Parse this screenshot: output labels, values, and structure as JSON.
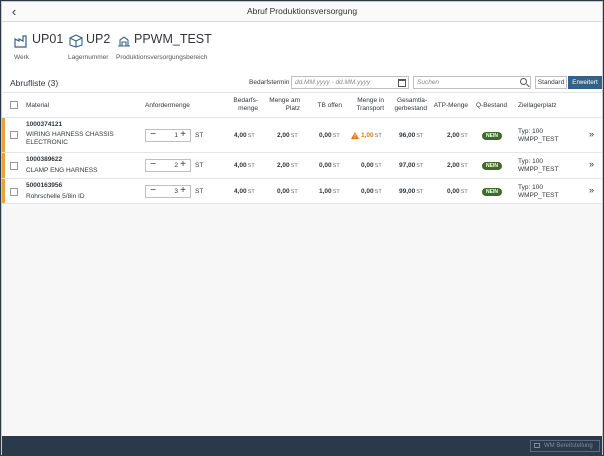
{
  "window": {
    "title": "Abruf Produktionsversorgung"
  },
  "header": {
    "items": [
      {
        "value": "UP01",
        "label": "Werk",
        "icon": "factory-icon"
      },
      {
        "value": "UP2",
        "label": "Lagernummer",
        "icon": "warehouse-box-icon"
      },
      {
        "value": "PPWM_TEST",
        "label": "Produktionsversorgungsbereich",
        "icon": "supply-area-icon"
      }
    ]
  },
  "list": {
    "title": "Abrufliste (3)",
    "date_label": "Bedarfstermin",
    "date_placeholder": "dd.MM.yyyy - dd.MM.yyyy",
    "search_placeholder": "Suchen",
    "btn_standard": "Standard",
    "btn_erweitert": "Erweitert"
  },
  "columns": {
    "material": "Material",
    "anfordermenge": "Anfordermenge",
    "bedarfsmenge": [
      "Bedarfs-",
      "menge"
    ],
    "menge_platz": [
      "Menge am",
      "Platz"
    ],
    "tb_offen": "TB offen",
    "transport": [
      "Menge in",
      "Transport"
    ],
    "gesamt": [
      "Gesamtla-",
      "gerbestand"
    ],
    "atp": "ATP-Menge",
    "qbestand": "Q-Bestand",
    "ziellager": "Ziellagerplatz"
  },
  "rows": [
    {
      "material": "1000374121",
      "desc_1": "WIRING HARNESS CHASSIS",
      "desc_2": "ELECTRONIC",
      "qty": "1",
      "unit": "ST",
      "bedarf": "4,00",
      "platz": "2,00",
      "tb": "0,00",
      "transport": "1,00",
      "gesamt": "96,00",
      "atp": "2,00",
      "u": "ST",
      "q": "NEIN",
      "typ": "Typ: 100",
      "platz_name": "WMPP_TEST",
      "transport_warning": true
    },
    {
      "material": "1000389622",
      "desc_1": "CLAMP ENG HARNESS",
      "desc_2": "",
      "qty": "2",
      "unit": "ST",
      "bedarf": "4,00",
      "platz": "2,00",
      "tb": "0,00",
      "transport": "0,00",
      "gesamt": "97,00",
      "atp": "2,00",
      "u": "ST",
      "q": "NEIN",
      "typ": "Typ: 100",
      "platz_name": "WMPP_TEST",
      "transport_warning": false
    },
    {
      "material": "5000163956",
      "desc_1": "Rohrschelle 5/8in ID",
      "desc_2": "",
      "qty": "3",
      "unit": "ST",
      "bedarf": "4,00",
      "platz": "0,00",
      "tb": "1,00",
      "transport": "0,00",
      "gesamt": "99,00",
      "atp": "0,00",
      "u": "ST",
      "q": "NEIN",
      "typ": "Typ: 100",
      "platz_name": "WMPP_TEST",
      "transport_warning": false
    }
  ],
  "footer": {
    "wm_button": "WM Bereitstellung"
  },
  "colors": {
    "accent": "#346187",
    "row_marker": "#e9a23b",
    "warning": "#e9730c",
    "badge": "#3f6b2a",
    "footer_bg": "#2b3a4a"
  }
}
